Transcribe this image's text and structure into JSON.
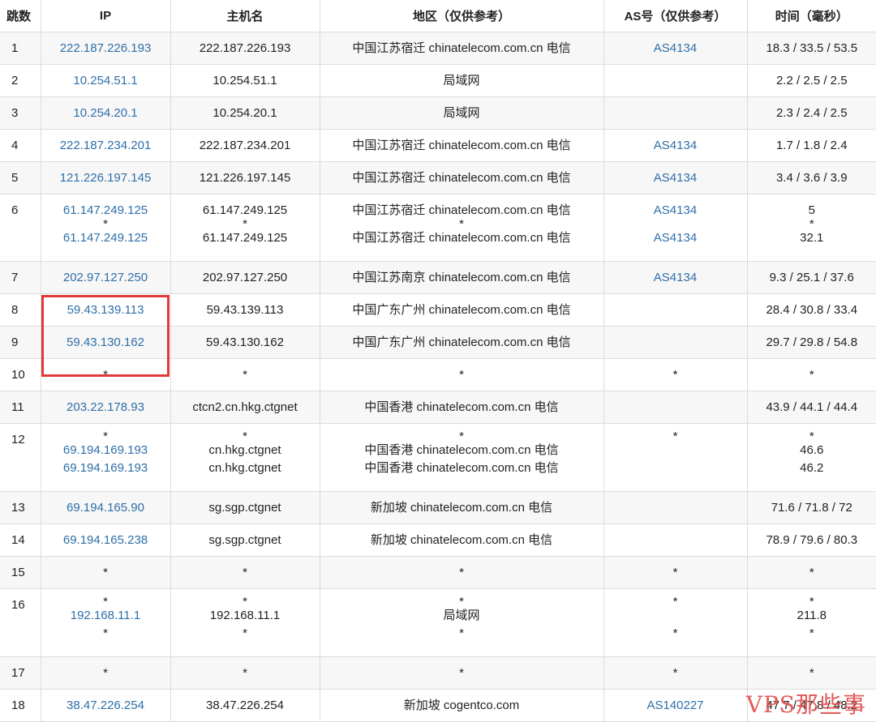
{
  "headers": [
    "跳数",
    "IP",
    "主机名",
    "地区（仅供参考）",
    "AS号（仅供参考）",
    "时间（毫秒）"
  ],
  "rows": [
    {
      "hop": "1",
      "ips": [
        "222.187.226.193"
      ],
      "hosts": [
        "222.187.226.193"
      ],
      "regions": [
        "中国江苏宿迁 chinatelecom.com.cn 电信"
      ],
      "as": [
        "AS4134"
      ],
      "times": [
        "18.3 / 33.5 / 53.5"
      ]
    },
    {
      "hop": "2",
      "ips": [
        "10.254.51.1"
      ],
      "hosts": [
        "10.254.51.1"
      ],
      "regions": [
        "局域网"
      ],
      "as": [
        ""
      ],
      "times": [
        "2.2 / 2.5 / 2.5"
      ]
    },
    {
      "hop": "3",
      "ips": [
        "10.254.20.1"
      ],
      "hosts": [
        "10.254.20.1"
      ],
      "regions": [
        "局域网"
      ],
      "as": [
        ""
      ],
      "times": [
        "2.3 / 2.4 / 2.5"
      ]
    },
    {
      "hop": "4",
      "ips": [
        "222.187.234.201"
      ],
      "hosts": [
        "222.187.234.201"
      ],
      "regions": [
        "中国江苏宿迁 chinatelecom.com.cn 电信"
      ],
      "as": [
        "AS4134"
      ],
      "times": [
        "1.7 / 1.8 / 2.4"
      ]
    },
    {
      "hop": "5",
      "ips": [
        "121.226.197.145"
      ],
      "hosts": [
        "121.226.197.145"
      ],
      "regions": [
        "中国江苏宿迁 chinatelecom.com.cn 电信"
      ],
      "as": [
        "AS4134"
      ],
      "times": [
        "3.4 / 3.6 / 3.9"
      ]
    },
    {
      "hop": "6",
      "ips": [
        "61.147.249.125",
        "*",
        "61.147.249.125"
      ],
      "hosts": [
        "61.147.249.125",
        "*",
        "61.147.249.125"
      ],
      "regions": [
        "中国江苏宿迁 chinatelecom.com.cn 电信",
        "*",
        "中国江苏宿迁 chinatelecom.com.cn 电信"
      ],
      "as": [
        "AS4134",
        "",
        "AS4134"
      ],
      "times": [
        "5",
        "*",
        "32.1"
      ]
    },
    {
      "hop": "7",
      "ips": [
        "202.97.127.250"
      ],
      "hosts": [
        "202.97.127.250"
      ],
      "regions": [
        "中国江苏南京 chinatelecom.com.cn 电信"
      ],
      "as": [
        "AS4134"
      ],
      "times": [
        "9.3 / 25.1 / 37.6"
      ]
    },
    {
      "hop": "8",
      "ips": [
        "59.43.139.113"
      ],
      "hosts": [
        "59.43.139.113"
      ],
      "regions": [
        "中国广东广州 chinatelecom.com.cn 电信"
      ],
      "as": [
        ""
      ],
      "times": [
        "28.4 / 30.8 / 33.4"
      ]
    },
    {
      "hop": "9",
      "ips": [
        "59.43.130.162"
      ],
      "hosts": [
        "59.43.130.162"
      ],
      "regions": [
        "中国广东广州 chinatelecom.com.cn 电信"
      ],
      "as": [
        ""
      ],
      "times": [
        "29.7 / 29.8 / 54.8"
      ]
    },
    {
      "hop": "10",
      "ips": [
        "*"
      ],
      "hosts": [
        "*"
      ],
      "regions": [
        "*"
      ],
      "as": [
        "*"
      ],
      "times": [
        "*"
      ]
    },
    {
      "hop": "11",
      "ips": [
        "203.22.178.93"
      ],
      "hosts": [
        "ctcn2.cn.hkg.ctgnet"
      ],
      "regions": [
        "中国香港 chinatelecom.com.cn 电信"
      ],
      "as": [
        ""
      ],
      "times": [
        "43.9 / 44.1 / 44.4"
      ]
    },
    {
      "hop": "12",
      "ips": [
        "*",
        "69.194.169.193",
        "69.194.169.193"
      ],
      "hosts": [
        "*",
        "cn.hkg.ctgnet",
        "cn.hkg.ctgnet"
      ],
      "regions": [
        "*",
        "中国香港 chinatelecom.com.cn 电信",
        "中国香港 chinatelecom.com.cn 电信"
      ],
      "as": [
        "*",
        "",
        ""
      ],
      "times": [
        "*",
        "46.6",
        "46.2"
      ]
    },
    {
      "hop": "13",
      "ips": [
        "69.194.165.90"
      ],
      "hosts": [
        "sg.sgp.ctgnet"
      ],
      "regions": [
        "新加坡 chinatelecom.com.cn 电信"
      ],
      "as": [
        ""
      ],
      "times": [
        "71.6 / 71.8 / 72"
      ]
    },
    {
      "hop": "14",
      "ips": [
        "69.194.165.238"
      ],
      "hosts": [
        "sg.sgp.ctgnet"
      ],
      "regions": [
        "新加坡 chinatelecom.com.cn 电信"
      ],
      "as": [
        ""
      ],
      "times": [
        "78.9 / 79.6 / 80.3"
      ]
    },
    {
      "hop": "15",
      "ips": [
        "*"
      ],
      "hosts": [
        "*"
      ],
      "regions": [
        "*"
      ],
      "as": [
        "*"
      ],
      "times": [
        "*"
      ]
    },
    {
      "hop": "16",
      "ips": [
        "*",
        "192.168.11.1",
        "*"
      ],
      "hosts": [
        "*",
        "192.168.11.1",
        "*"
      ],
      "regions": [
        "*",
        "局域网",
        "*"
      ],
      "as": [
        "*",
        "",
        "*"
      ],
      "times": [
        "*",
        "211.8",
        "*"
      ]
    },
    {
      "hop": "17",
      "ips": [
        "*"
      ],
      "hosts": [
        "*"
      ],
      "regions": [
        "*"
      ],
      "as": [
        "*"
      ],
      "times": [
        "*"
      ]
    },
    {
      "hop": "18",
      "ips": [
        "38.47.226.254"
      ],
      "hosts": [
        "38.47.226.254"
      ],
      "regions": [
        "新加坡 cogentco.com"
      ],
      "as": [
        "AS140227"
      ],
      "times": [
        "47.7 / 47.8 / 48.2"
      ]
    }
  ],
  "highlight": {
    "color": "#e03a3a"
  },
  "watermark": "VPS那些事",
  "colors": {
    "link": "#2f6fa8",
    "stripe": "#f7f7f7",
    "border": "#dcdcdc"
  }
}
